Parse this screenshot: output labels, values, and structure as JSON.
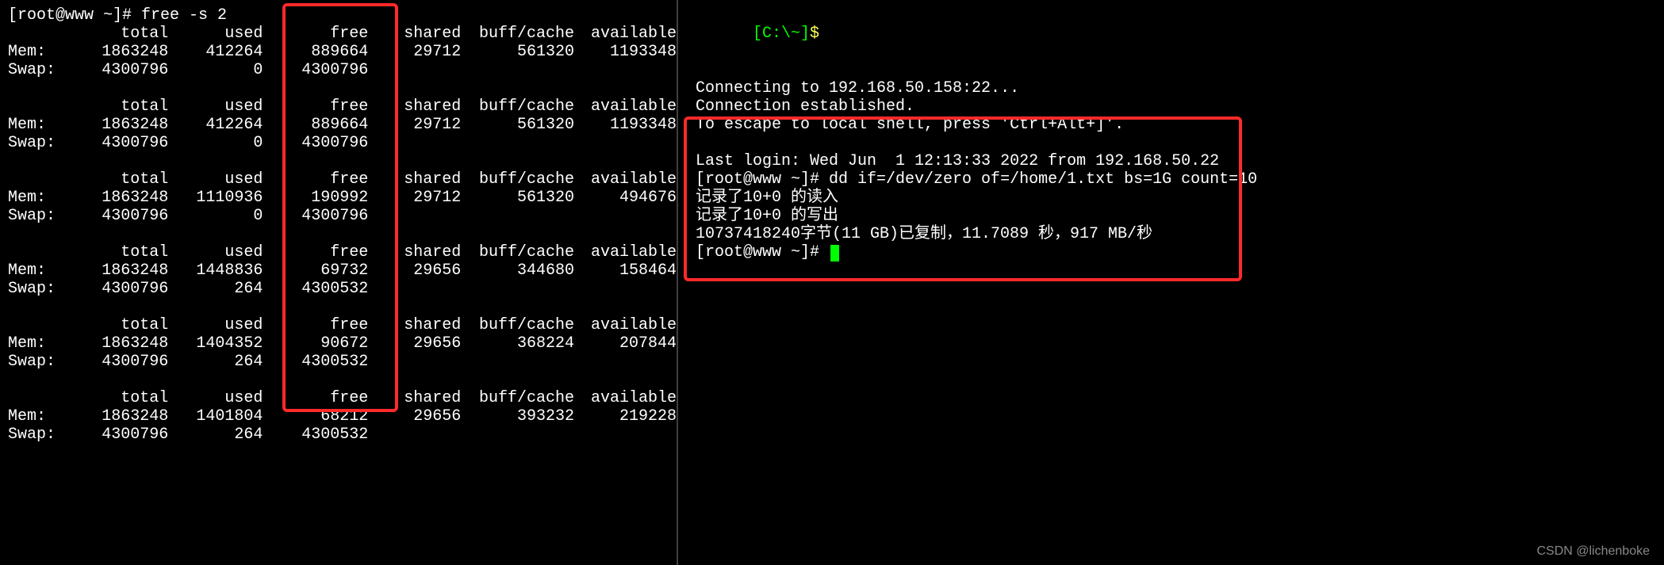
{
  "left": {
    "prompt": "[root@www ~]# free -s 2",
    "headers": {
      "total": "total",
      "used": "used",
      "free": "free",
      "shared": "shared",
      "buff": "buff/cache",
      "avail": "available"
    },
    "blocks": [
      {
        "mem": {
          "lbl": "Mem:",
          "total": "1863248",
          "used": "412264",
          "free": "889664",
          "shared": "29712",
          "buff": "561320",
          "avail": "1193348"
        },
        "swap": {
          "lbl": "Swap:",
          "total": "4300796",
          "used": "0",
          "free": "4300796"
        }
      },
      {
        "mem": {
          "lbl": "Mem:",
          "total": "1863248",
          "used": "412264",
          "free": "889664",
          "shared": "29712",
          "buff": "561320",
          "avail": "1193348"
        },
        "swap": {
          "lbl": "Swap:",
          "total": "4300796",
          "used": "0",
          "free": "4300796"
        }
      },
      {
        "mem": {
          "lbl": "Mem:",
          "total": "1863248",
          "used": "1110936",
          "free": "190992",
          "shared": "29712",
          "buff": "561320",
          "avail": "494676"
        },
        "swap": {
          "lbl": "Swap:",
          "total": "4300796",
          "used": "0",
          "free": "4300796"
        }
      },
      {
        "mem": {
          "lbl": "Mem:",
          "total": "1863248",
          "used": "1448836",
          "free": "69732",
          "shared": "29656",
          "buff": "344680",
          "avail": "158464"
        },
        "swap": {
          "lbl": "Swap:",
          "total": "4300796",
          "used": "264",
          "free": "4300532"
        }
      },
      {
        "mem": {
          "lbl": "Mem:",
          "total": "1863248",
          "used": "1404352",
          "free": "90672",
          "shared": "29656",
          "buff": "368224",
          "avail": "207844"
        },
        "swap": {
          "lbl": "Swap:",
          "total": "4300796",
          "used": "264",
          "free": "4300532"
        }
      },
      {
        "mem": {
          "lbl": "Mem:",
          "total": "1863248",
          "used": "1401804",
          "free": "68212",
          "shared": "29656",
          "buff": "393232",
          "avail": "219228"
        },
        "swap": {
          "lbl": "Swap:",
          "total": "4300796",
          "used": "264",
          "free": "4300532"
        }
      }
    ]
  },
  "right": {
    "old_prompt_host": "[C:\\~]",
    "old_prompt_dollar": "$",
    "lines": [
      "Connecting to 192.168.50.158:22...",
      "Connection established.",
      "To escape to local shell, press 'Ctrl+Alt+]'.",
      "",
      "Last login: Wed Jun  1 12:13:33 2022 from 192.168.50.22",
      "[root@www ~]# dd if=/dev/zero of=/home/1.txt bs=1G count=10",
      "记录了10+0 的读入",
      "记录了10+0 的写出",
      "10737418240字节(11 GB)已复制，11.7089 秒，917 MB/秒",
      "[root@www ~]# "
    ]
  },
  "watermark": "CSDN @lichenboke"
}
